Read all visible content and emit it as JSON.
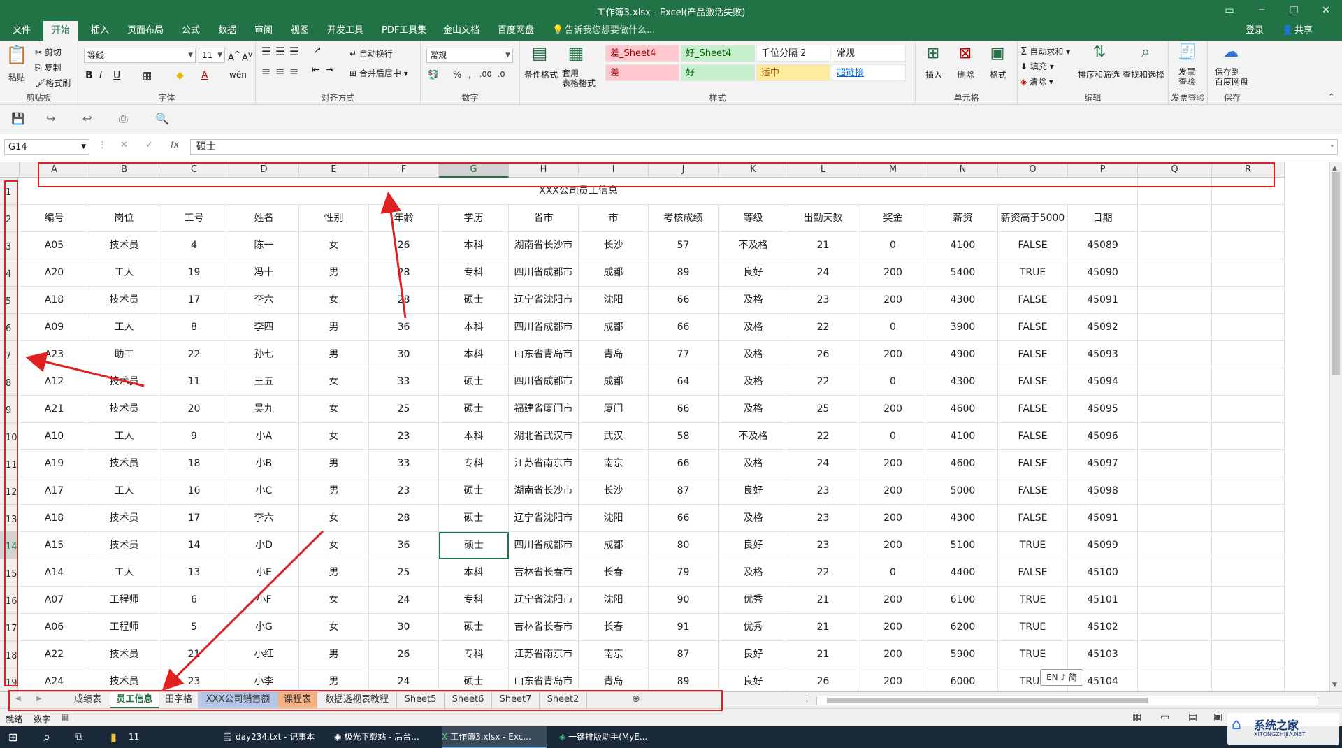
{
  "app": {
    "window_title": "工作簿3.xlsx - Excel(产品激活失败)",
    "login": "登录",
    "share": "共享"
  },
  "menu": {
    "tabs": [
      "文件",
      "开始",
      "插入",
      "页面布局",
      "公式",
      "数据",
      "审阅",
      "视图",
      "开发工具",
      "PDF工具集",
      "金山文档",
      "百度网盘"
    ],
    "active_tab": "开始",
    "tell_me": "告诉我您想要做什么..."
  },
  "ribbon": {
    "clipboard": {
      "label": "剪贴板",
      "paste": "粘贴",
      "cut": "剪切",
      "copy": "复制",
      "format_painter": "格式刷"
    },
    "font": {
      "label": "字体",
      "font_name": "等线",
      "font_size": "11"
    },
    "alignment": {
      "label": "对齐方式",
      "wrap": "自动换行",
      "merge": "合并后居中"
    },
    "number": {
      "label": "数字",
      "format": "常规"
    },
    "styles": {
      "label": "样式",
      "conditional": "条件格式",
      "table_format": "套用\n表格格式",
      "cells": [
        {
          "text": "差_Sheet4",
          "bg": "#ffc7ce",
          "fg": "#9c0006"
        },
        {
          "text": "好_Sheet4",
          "bg": "#c6efce",
          "fg": "#006100"
        },
        {
          "text": "千位分隔 2",
          "bg": "#ffffff",
          "fg": "#222222"
        },
        {
          "text": "常规",
          "bg": "#ffffff",
          "fg": "#222222"
        },
        {
          "text": "差",
          "bg": "#ffc7ce",
          "fg": "#9c0006"
        },
        {
          "text": "好",
          "bg": "#c6efce",
          "fg": "#006100"
        },
        {
          "text": "适中",
          "bg": "#ffeb9c",
          "fg": "#9c5700"
        },
        {
          "text": "超链接",
          "bg": "#ffffff",
          "fg": "#0563c1"
        }
      ]
    },
    "cells_group": {
      "label": "单元格",
      "insert": "插入",
      "delete": "删除",
      "format": "格式"
    },
    "editing": {
      "label": "编辑",
      "autosum": "自动求和",
      "fill": "填充",
      "clear": "清除",
      "sort": "排序和筛选",
      "find": "查找和选择"
    },
    "invoice": {
      "label": "发票查验",
      "btn": "发票\n查验"
    },
    "save": {
      "label": "保存",
      "btn": "保存到\n百度网盘"
    }
  },
  "formula_bar": {
    "name_box": "G14",
    "value": "硕士",
    "fx": "fx"
  },
  "columns": [
    "A",
    "B",
    "C",
    "D",
    "E",
    "F",
    "G",
    "H",
    "I",
    "J",
    "K",
    "L",
    "M",
    "N",
    "O",
    "P",
    "Q",
    "R"
  ],
  "selected_column": "G",
  "selected_row": "14",
  "rows": [
    "1",
    "2",
    "3",
    "4",
    "5",
    "6",
    "7",
    "8",
    "9",
    "10",
    "11",
    "12",
    "13",
    "14",
    "15",
    "16",
    "17",
    "18",
    "19"
  ],
  "sheet_title": "XXX公司员工信息",
  "table": {
    "headers": [
      "编号",
      "岗位",
      "工号",
      "姓名",
      "性别",
      "年龄",
      "学历",
      "省市",
      "市",
      "考核成绩",
      "等级",
      "出勤天数",
      "奖金",
      "薪资",
      "薪资高于5000",
      "日期"
    ],
    "rows": [
      [
        "A05",
        "技术员",
        "4",
        "陈一",
        "女",
        "26",
        "本科",
        "湖南省长沙市",
        "长沙",
        "57",
        "不及格",
        "21",
        "0",
        "4100",
        "FALSE",
        "45089"
      ],
      [
        "A20",
        "工人",
        "19",
        "冯十",
        "男",
        "28",
        "专科",
        "四川省成都市",
        "成都",
        "89",
        "良好",
        "24",
        "200",
        "5400",
        "TRUE",
        "45090"
      ],
      [
        "A18",
        "技术员",
        "17",
        "李六",
        "女",
        "28",
        "硕士",
        "辽宁省沈阳市",
        "沈阳",
        "66",
        "及格",
        "23",
        "200",
        "4300",
        "FALSE",
        "45091"
      ],
      [
        "A09",
        "工人",
        "8",
        "李四",
        "男",
        "36",
        "本科",
        "四川省成都市",
        "成都",
        "66",
        "及格",
        "22",
        "0",
        "3900",
        "FALSE",
        "45092"
      ],
      [
        "A23",
        "助工",
        "22",
        "孙七",
        "男",
        "30",
        "本科",
        "山东省青岛市",
        "青岛",
        "77",
        "及格",
        "26",
        "200",
        "4900",
        "FALSE",
        "45093"
      ],
      [
        "A12",
        "技术员",
        "11",
        "王五",
        "女",
        "33",
        "硕士",
        "四川省成都市",
        "成都",
        "64",
        "及格",
        "22",
        "0",
        "4300",
        "FALSE",
        "45094"
      ],
      [
        "A21",
        "技术员",
        "20",
        "吴九",
        "女",
        "25",
        "硕士",
        "福建省厦门市",
        "厦门",
        "66",
        "及格",
        "25",
        "200",
        "4600",
        "FALSE",
        "45095"
      ],
      [
        "A10",
        "工人",
        "9",
        "小A",
        "女",
        "23",
        "本科",
        "湖北省武汉市",
        "武汉",
        "58",
        "不及格",
        "22",
        "0",
        "4100",
        "FALSE",
        "45096"
      ],
      [
        "A19",
        "技术员",
        "18",
        "小B",
        "男",
        "33",
        "专科",
        "江苏省南京市",
        "南京",
        "66",
        "及格",
        "24",
        "200",
        "4600",
        "FALSE",
        "45097"
      ],
      [
        "A17",
        "工人",
        "16",
        "小C",
        "男",
        "23",
        "硕士",
        "湖南省长沙市",
        "长沙",
        "87",
        "良好",
        "23",
        "200",
        "5000",
        "FALSE",
        "45098"
      ],
      [
        "A18",
        "技术员",
        "17",
        "李六",
        "女",
        "28",
        "硕士",
        "辽宁省沈阳市",
        "沈阳",
        "66",
        "及格",
        "23",
        "200",
        "4300",
        "FALSE",
        "45091"
      ],
      [
        "A15",
        "技术员",
        "14",
        "小D",
        "女",
        "36",
        "硕士",
        "四川省成都市",
        "成都",
        "80",
        "良好",
        "23",
        "200",
        "5100",
        "TRUE",
        "45099"
      ],
      [
        "A14",
        "工人",
        "13",
        "小E",
        "男",
        "25",
        "本科",
        "吉林省长春市",
        "长春",
        "79",
        "及格",
        "22",
        "0",
        "4400",
        "FALSE",
        "45100"
      ],
      [
        "A07",
        "工程师",
        "6",
        "小F",
        "女",
        "24",
        "专科",
        "辽宁省沈阳市",
        "沈阳",
        "90",
        "优秀",
        "21",
        "200",
        "6100",
        "TRUE",
        "45101"
      ],
      [
        "A06",
        "工程师",
        "5",
        "小G",
        "女",
        "30",
        "硕士",
        "吉林省长春市",
        "长春",
        "91",
        "优秀",
        "21",
        "200",
        "6200",
        "TRUE",
        "45102"
      ],
      [
        "A22",
        "技术员",
        "21",
        "小红",
        "男",
        "26",
        "专科",
        "江苏省南京市",
        "南京",
        "87",
        "良好",
        "21",
        "200",
        "5900",
        "TRUE",
        "45103"
      ],
      [
        "A24",
        "技术员",
        "23",
        "小李",
        "男",
        "24",
        "硕士",
        "山东省青岛市",
        "青岛",
        "89",
        "良好",
        "26",
        "200",
        "6000",
        "TRUE",
        "45104"
      ]
    ]
  },
  "sheets": [
    {
      "name": "成绩表",
      "bg": "#f0f0f0",
      "active": false
    },
    {
      "name": "员工信息",
      "bg": "#ffffff",
      "active": true
    },
    {
      "name": "田字格",
      "bg": "#f0f0f0",
      "active": false
    },
    {
      "name": "XXX公司销售额",
      "bg": "#b4c6e7",
      "active": false
    },
    {
      "name": "课程表",
      "bg": "#f4b183",
      "active": false
    },
    {
      "name": "数据透视表教程",
      "bg": "#f0f0f0",
      "active": false
    },
    {
      "name": "Sheet5",
      "bg": "#f0f0f0",
      "active": false
    },
    {
      "name": "Sheet6",
      "bg": "#f0f0f0",
      "active": false
    },
    {
      "name": "Sheet7",
      "bg": "#f0f0f0",
      "active": false
    },
    {
      "name": "Sheet2",
      "bg": "#f0f0f0",
      "active": false
    }
  ],
  "ime": "EN ♪ 简",
  "status": {
    "ready": "就绪",
    "mode": "数字"
  },
  "taskbar": {
    "folder_count": "11",
    "items": [
      "day234.txt - 记事本",
      "极光下载站 - 后台...",
      "工作簿3.xlsx - Exc...",
      "一键排版助手(MyE..."
    ]
  },
  "watermark": {
    "text": "系统之家",
    "sub": "XITONGZHIJIA.NET"
  },
  "colors": {
    "excel_green": "#217346",
    "annotation_red": "#e02020",
    "selection_green": "#217346"
  }
}
